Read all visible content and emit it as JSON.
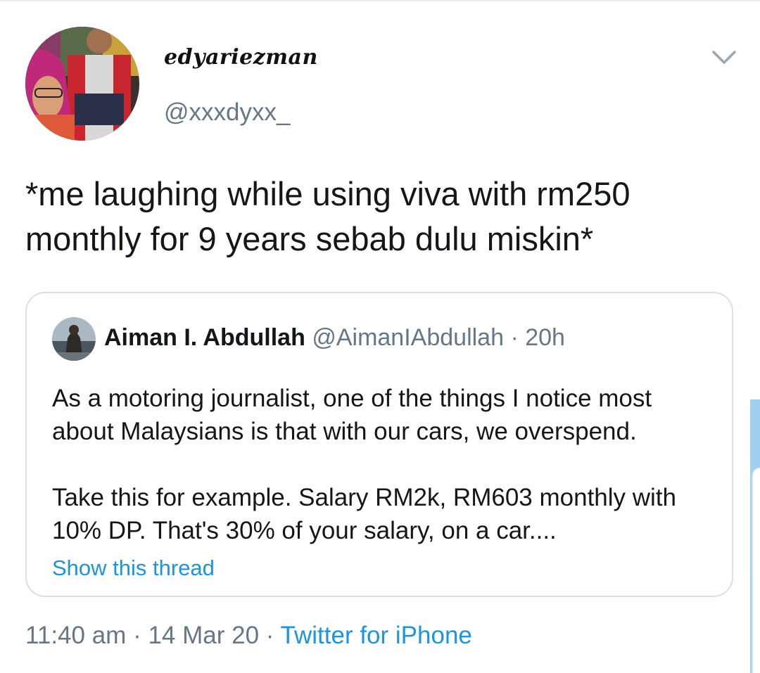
{
  "author": {
    "display_name": "edyariezman",
    "handle": "@xxxdyxx_",
    "avatar_icon": "profile-photo"
  },
  "tweet": {
    "text": "*me laughing while using viva with rm250 monthly for 9 years sebab dulu miskin*"
  },
  "quoted_tweet": {
    "name": "Aiman I. Abdullah",
    "handle": "@AimanIAbdullah",
    "separator": " · ",
    "time": "20h",
    "paragraph_1": "As a motoring journalist, one of the things I notice most about Malaysians is that with our cars, we overspend.",
    "paragraph_2": "Take this for example. Salary RM2k, RM603 monthly with 10% DP. That's 30% of your salary, on a car....",
    "show_thread_label": "Show this thread"
  },
  "meta": {
    "time": "11:40 am",
    "separator": " · ",
    "date": "14 Mar 20",
    "source": "Twitter for iPhone"
  },
  "icons": {
    "more_menu": "chevron-down-icon"
  },
  "colors": {
    "link": "#1b95e0",
    "secondary_text": "#657786",
    "card_border": "#d9e1e8"
  }
}
